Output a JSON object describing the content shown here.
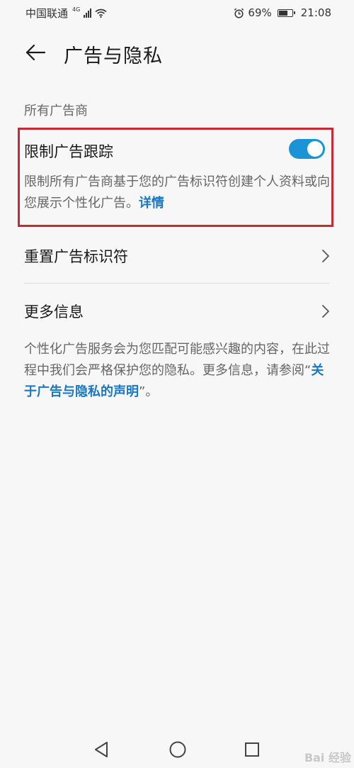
{
  "status_bar": {
    "carrier": "中国联通",
    "network_type": "4G",
    "alarm_icon": "alarm-icon",
    "battery_percent": "69%",
    "time": "21:08"
  },
  "header": {
    "back_icon": "arrow-left-icon",
    "title": "广告与隐私"
  },
  "section": {
    "label": "所有广告商"
  },
  "limit_tracking": {
    "title": "限制广告跟踪",
    "enabled": true,
    "description": "限制所有广告商基于您的广告标识符创建个人资料或向您展示个性化广告。",
    "link_label": "详情"
  },
  "items": [
    {
      "label": "重置广告标识符",
      "icon": "chevron-right-icon"
    },
    {
      "label": "更多信息",
      "icon": "chevron-right-icon"
    }
  ],
  "footer": {
    "text_before": "个性化广告服务会为您匹配可能感兴趣的内容，在此过程中我们会严格保护您的隐私。更多信息，请参阅“",
    "link_label": "关于广告与隐私的声明",
    "text_after": "”。"
  },
  "nav": {
    "back_icon": "triangle-back-icon",
    "home_icon": "circle-home-icon",
    "recents_icon": "square-recents-icon"
  },
  "watermark": "Bai 经验",
  "colors": {
    "accent": "#1a94d6",
    "link": "#1a78c2",
    "highlight_border": "#c62a35",
    "background": "#f7f7f7"
  }
}
